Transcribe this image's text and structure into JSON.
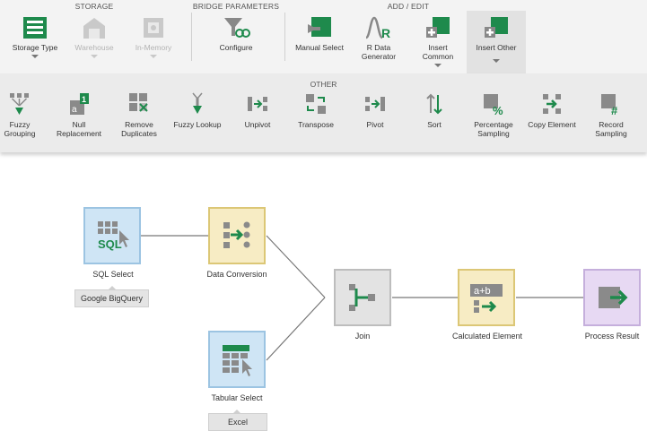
{
  "ribbon": {
    "groups": {
      "storage": "STORAGE",
      "bridge": "BRIDGE PARAMETERS",
      "add_edit": "ADD / EDIT",
      "other": "OTHER"
    },
    "buttons": {
      "storage_type": "Storage Type",
      "warehouse": "Warehouse",
      "in_memory": "In-Memory",
      "configure": "Configure",
      "manual_select": "Manual Select",
      "r_data_gen_1": "R Data",
      "r_data_gen_2": "Generator",
      "insert_common_1": "Insert",
      "insert_common_2": "Common",
      "insert_other": "Insert Other"
    },
    "other_items": [
      {
        "l1": "Fuzzy",
        "l2": "Grouping"
      },
      {
        "l1": "Null",
        "l2": "Replacement"
      },
      {
        "l1": "Remove",
        "l2": "Duplicates"
      },
      {
        "l1": "Fuzzy Lookup",
        "l2": ""
      },
      {
        "l1": "Unpivot",
        "l2": ""
      },
      {
        "l1": "Transpose",
        "l2": ""
      },
      {
        "l1": "Pivot",
        "l2": ""
      },
      {
        "l1": "Sort",
        "l2": ""
      },
      {
        "l1": "Percentage",
        "l2": "Sampling"
      },
      {
        "l1": "Copy Element",
        "l2": ""
      },
      {
        "l1": "Record",
        "l2": "Sampling"
      }
    ]
  },
  "flow": {
    "nodes": {
      "sql_select": "SQL Select",
      "data_conversion": "Data Conversion",
      "tabular_select": "Tabular Select",
      "join": "Join",
      "calculated_element": "Calculated Element",
      "process_result": "Process Result"
    },
    "tags": {
      "sql_source": "Google BigQuery",
      "tabular_source": "Excel"
    },
    "icon_text": {
      "sql": "SQL",
      "calc": "a+b"
    }
  },
  "colors": {
    "accent_green": "#1e8a4c",
    "icon_gray": "#8a8a8a",
    "node_blue": "#cfe5f5",
    "node_yellow": "#f7ecc4",
    "node_gray": "#e3e3e3",
    "node_purple": "#e7d9f3"
  }
}
